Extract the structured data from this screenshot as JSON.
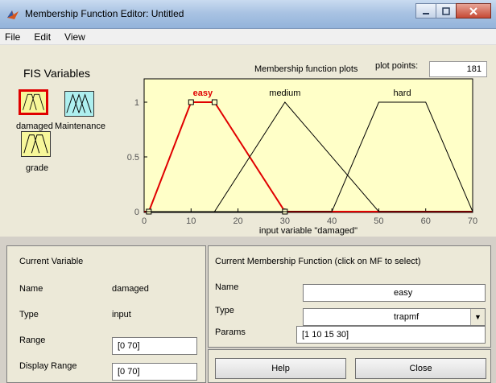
{
  "window": {
    "title": "Membership Function Editor: Untitled",
    "controls": [
      "minimize",
      "maximize",
      "close"
    ]
  },
  "menu": [
    "File",
    "Edit",
    "View"
  ],
  "fis_variables": {
    "title": "FIS Variables",
    "inputs": [
      {
        "name": "damaged",
        "selected": true
      },
      {
        "name": "grade",
        "selected": false
      }
    ],
    "outputs": [
      {
        "name": "Maintenance",
        "selected": false
      }
    ]
  },
  "plot_header": {
    "title": "Membership function plots",
    "plot_points_label": "plot points:",
    "plot_points_value": "181"
  },
  "chart_data": {
    "type": "line",
    "xlabel": "input variable \"damaged\"",
    "xlim": [
      0,
      70
    ],
    "ylim": [
      0,
      1
    ],
    "xticks": [
      "0",
      "10",
      "20",
      "30",
      "40",
      "50",
      "60",
      "70"
    ],
    "yticks": [
      "0",
      "0.5",
      "1"
    ],
    "series": [
      {
        "name": "easy",
        "type": "trapmf",
        "params": [
          1,
          10,
          15,
          30
        ],
        "color": "#e00000",
        "selected": true
      },
      {
        "name": "medium",
        "type": "trimf",
        "params": [
          15,
          30,
          50
        ],
        "color": "#000000",
        "selected": false
      },
      {
        "name": "hard",
        "type": "trapmf",
        "params": [
          40,
          50,
          60,
          70
        ],
        "color": "#000000",
        "selected": false
      }
    ]
  },
  "current_variable": {
    "header": "Current Variable",
    "name_label": "Name",
    "name_value": "damaged",
    "type_label": "Type",
    "type_value": "input",
    "range_label": "Range",
    "range_value": "[0 70]",
    "display_range_label": "Display Range",
    "display_range_value": "[0 70]"
  },
  "current_mf": {
    "header": "Current Membership Function (click on MF to select)",
    "name_label": "Name",
    "name_value": "easy",
    "type_label": "Type",
    "type_value": "trapmf",
    "params_label": "Params",
    "params_value": "[1 10 15 30]"
  },
  "buttons": {
    "help": "Help",
    "close": "Close"
  },
  "colors": {
    "plot_bg": "#ffffc8",
    "selected_mf": "#e00000",
    "panel_bg": "#ece9d8"
  }
}
